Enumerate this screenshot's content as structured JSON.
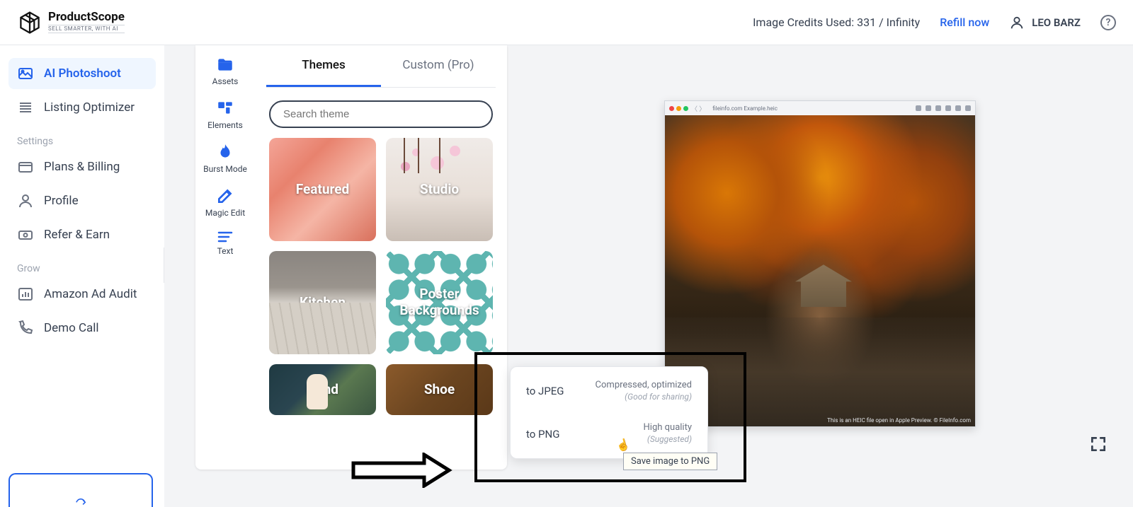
{
  "header": {
    "brand_title": "ProductScope",
    "brand_sub": "SELL SMARTER, WITH AI",
    "credits_label": "Image Credits Used: 331 / Infinity",
    "refill_label": "Refill now",
    "user_name": "LEO BARZ"
  },
  "sidebar": {
    "items": [
      {
        "label": "AI Photoshoot"
      },
      {
        "label": "Listing Optimizer"
      }
    ],
    "settings_label": "Settings",
    "settings_items": [
      {
        "label": "Plans & Billing"
      },
      {
        "label": "Profile"
      },
      {
        "label": "Refer & Earn"
      }
    ],
    "grow_label": "Grow",
    "grow_items": [
      {
        "label": "Amazon Ad Audit"
      },
      {
        "label": "Demo Call"
      }
    ]
  },
  "tools": {
    "assets": "Assets",
    "elements": "Elements",
    "burst": "Burst Mode",
    "magic": "Magic Edit",
    "text": "Text"
  },
  "tabs": {
    "themes": "Themes",
    "custom": "Custom (Pro)"
  },
  "search": {
    "placeholder": "Search theme"
  },
  "themes": {
    "featured": "Featured",
    "studio": "Studio",
    "kitchen": "Kitchen",
    "poster": "Poster Backgrounds",
    "hand": "Hand",
    "shoe": "Shoe"
  },
  "export": {
    "jpeg_label": "to JPEG",
    "jpeg_desc": "Compressed, optimized",
    "jpeg_sub": "(Good for sharing)",
    "png_label": "to PNG",
    "png_desc": "High quality",
    "png_sub": "(Suggested)"
  },
  "tooltip": "Save image to PNG",
  "preview": {
    "window_filename": "fileinfo.com Example.heic",
    "watermark": "This is an HEIC file open in Apple Preview. © FileInfo.com"
  }
}
